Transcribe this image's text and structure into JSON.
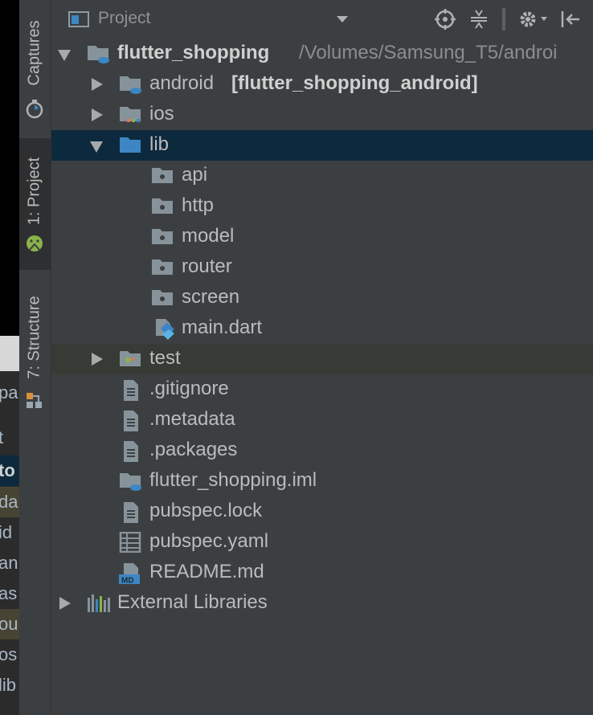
{
  "window": {
    "panel_title": "Project"
  },
  "left_stripe": {
    "tabs": [
      {
        "label": "Captures"
      },
      {
        "label": "1: Project"
      },
      {
        "label": "7: Structure"
      }
    ]
  },
  "background_fragments": [
    "pa",
    "t",
    "to",
    "da",
    "id",
    "an",
    "as",
    "ou",
    "os",
    "lib"
  ],
  "toolbar": {
    "dropdown_icon": "chevron-down-icon",
    "locate_icon": "crosshair-icon",
    "collapse_icon": "collapse-all-icon",
    "settings_icon": "gear-icon",
    "hide_icon": "hide-panel-icon"
  },
  "tree": {
    "root": {
      "name": "flutter_shopping",
      "path": "/Volumes/Samsung_T5/androi"
    },
    "items": [
      {
        "name": "android",
        "module": "[flutter_shopping_android]"
      },
      {
        "name": "ios"
      },
      {
        "name": "lib"
      },
      {
        "name": "api"
      },
      {
        "name": "http"
      },
      {
        "name": "model"
      },
      {
        "name": "router"
      },
      {
        "name": "screen"
      },
      {
        "name": "main.dart"
      },
      {
        "name": "test"
      },
      {
        "name": ".gitignore"
      },
      {
        "name": ".metadata"
      },
      {
        "name": ".packages"
      },
      {
        "name": "flutter_shopping.iml"
      },
      {
        "name": "pubspec.lock"
      },
      {
        "name": "pubspec.yaml"
      },
      {
        "name": "README.md"
      },
      {
        "name": "External Libraries"
      }
    ]
  },
  "colors": {
    "selection": "#0d293e",
    "folder": "#87939a",
    "folder_blue": "#3d86c3"
  }
}
